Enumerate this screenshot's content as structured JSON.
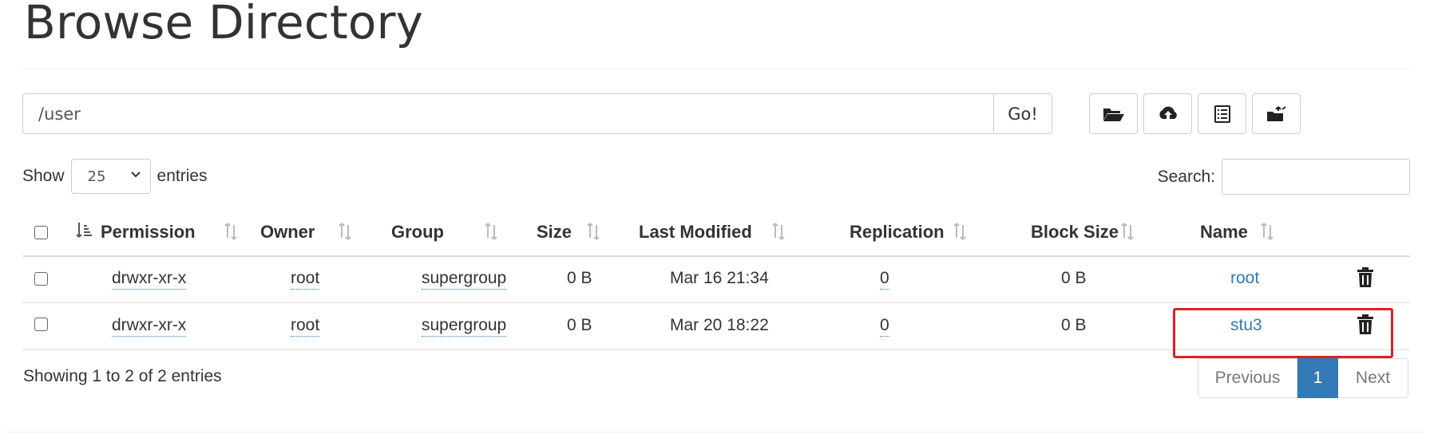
{
  "page": {
    "title": "Browse Directory"
  },
  "path_bar": {
    "value": "/user",
    "go_label": "Go!"
  },
  "toolbar": {
    "buttons": [
      {
        "icon": "folder-open-icon"
      },
      {
        "icon": "cloud-upload-icon"
      },
      {
        "icon": "list-alt-icon"
      },
      {
        "icon": "folder-move-icon"
      }
    ]
  },
  "length_menu": {
    "prefix": "Show",
    "selected": "25",
    "suffix": "entries"
  },
  "search": {
    "label": "Search:",
    "value": ""
  },
  "table": {
    "columns": [
      "Permission",
      "Owner",
      "Group",
      "Size",
      "Last Modified",
      "Replication",
      "Block Size",
      "Name"
    ],
    "rows": [
      {
        "permission": "drwxr-xr-x",
        "owner": "root",
        "group": "supergroup",
        "size": "0 B",
        "last_modified": "Mar 16 21:34",
        "replication": "0",
        "block_size": "0 B",
        "name": "root"
      },
      {
        "permission": "drwxr-xr-x",
        "owner": "root",
        "group": "supergroup",
        "size": "0 B",
        "last_modified": "Mar 20 18:22",
        "replication": "0",
        "block_size": "0 B",
        "name": "stu3"
      }
    ]
  },
  "info": "Showing 1 to 2 of 2 entries",
  "pagination": {
    "previous": "Previous",
    "current": "1",
    "next": "Next"
  },
  "colors": {
    "link": "#337ab7",
    "highlight": "#e02020"
  }
}
